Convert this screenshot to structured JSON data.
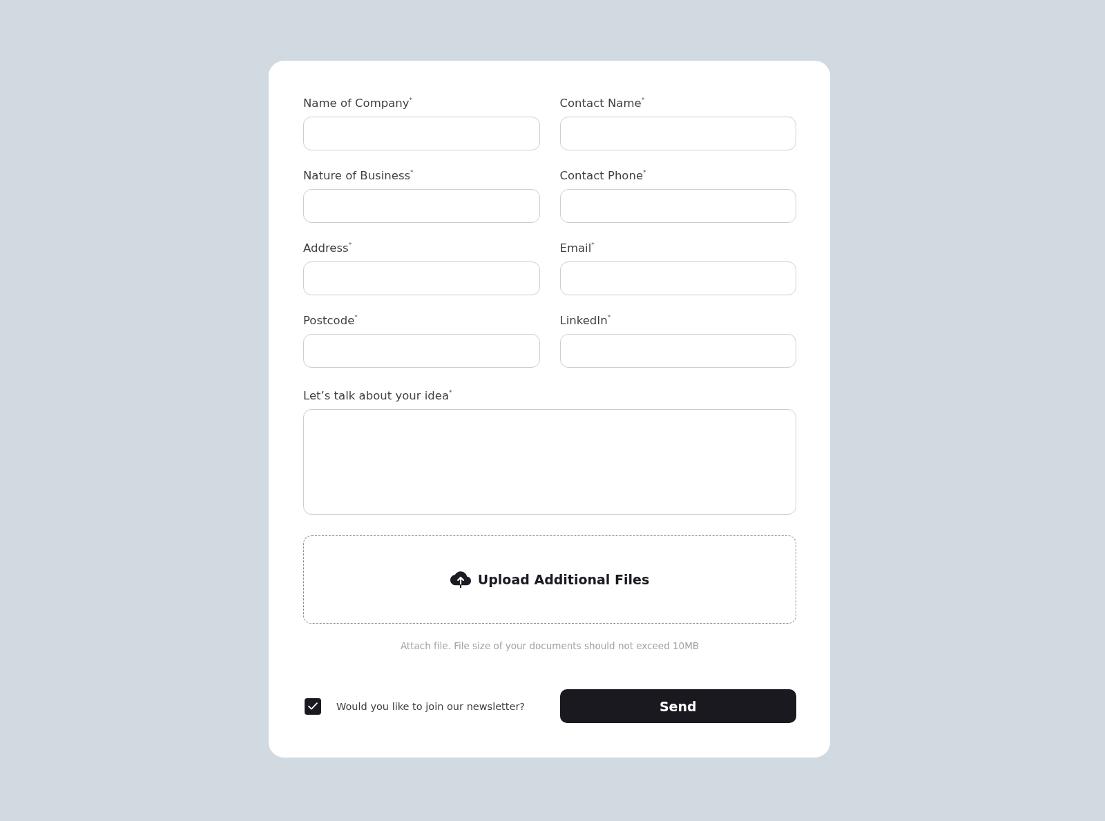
{
  "form": {
    "fields": [
      {
        "label": "Name of Company$^{*}$",
        "kind": "text"
      },
      {
        "label": "Contact Name$^{*}$",
        "kind": "text"
      },
      {
        "label": "Nature of Business$^{*}$",
        "kind": "text"
      },
      {
        "label": "Contact Phone$^{*}$",
        "kind": "text"
      },
      {
        "label": "Address$^{*}$",
        "kind": "text"
      },
      {
        "label": "Email$^{*}$",
        "kind": "text"
      },
      {
        "label": "Postcode$^{*}$",
        "kind": "text"
      },
      {
        "label": "LinkedIn$^{*}$",
        "kind": "text"
      },
      {
        "label": "Let’s talk about your idea$^{*}$",
        "kind": "textarea"
      }
    ],
    "upload": {
      "label": "Upload Additional Files",
      "hint": "Attach file. File size of your documents should not exceed 10MB"
    },
    "newsletter": {
      "label": "Would you like to join our newsletter?",
      "checked": true
    },
    "submit_button": "Send"
  }
}
